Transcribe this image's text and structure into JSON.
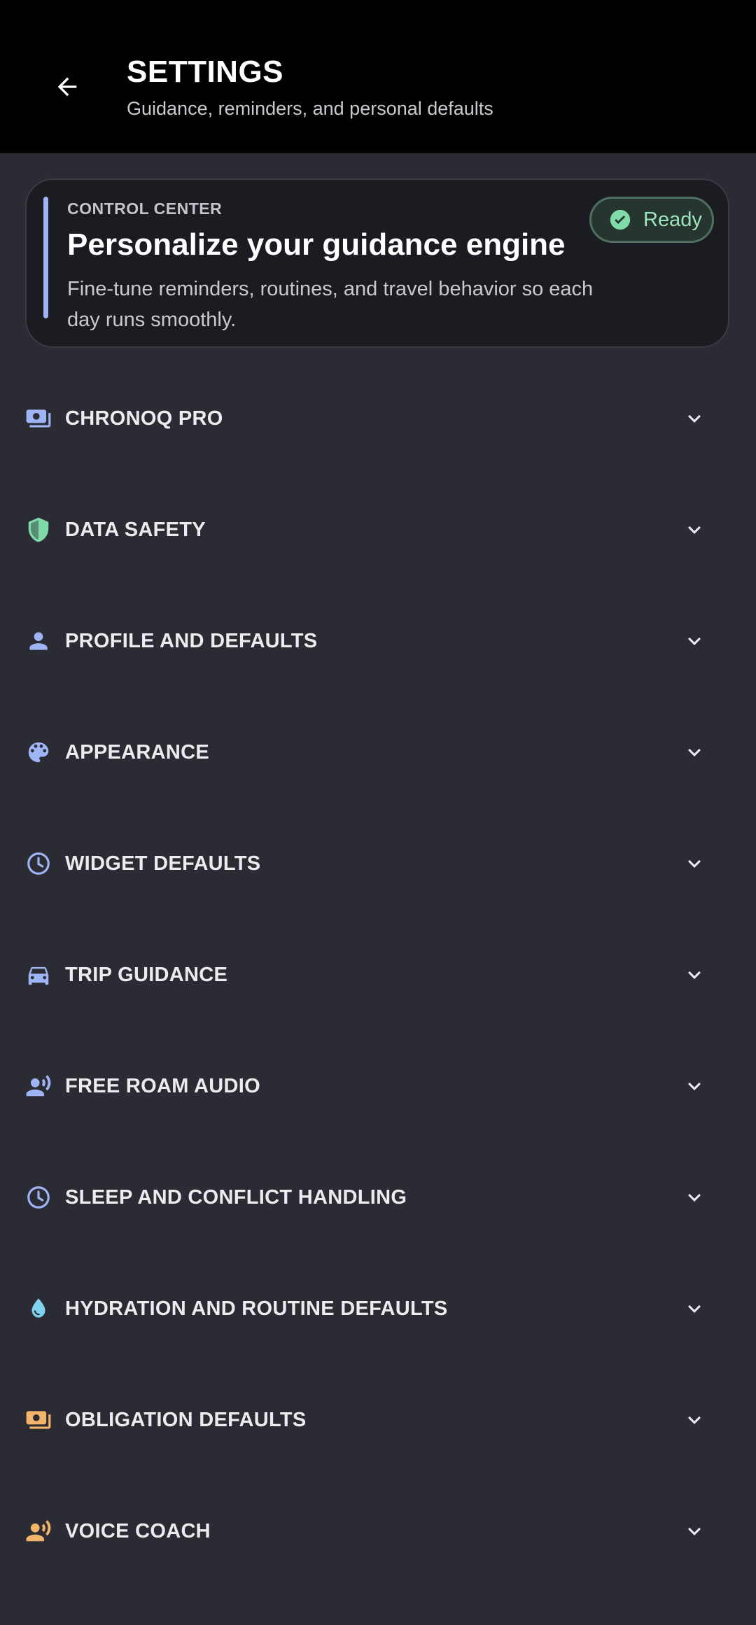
{
  "header": {
    "title": "SETTINGS",
    "subtitle": "Guidance, reminders, and personal defaults",
    "back_icon": "arrow-back-icon"
  },
  "hero": {
    "overline": "CONTROL CENTER",
    "title": "Personalize your guidance engine",
    "body": "Fine-tune reminders, routines, and travel behavior so each day runs smoothly.",
    "status_label": "Ready",
    "status_icon": "check-circle-icon",
    "accent_color": "#9fb4f5",
    "status_color": "#9ee3bf"
  },
  "sections": [
    {
      "label": "CHRONOQ PRO",
      "icon": "payments-icon",
      "icon_color": "#9fb4f5"
    },
    {
      "label": "DATA SAFETY",
      "icon": "shield-icon",
      "icon_color": "#7fdcaa"
    },
    {
      "label": "PROFILE AND DEFAULTS",
      "icon": "person-icon",
      "icon_color": "#9fb4f5"
    },
    {
      "label": "APPEARANCE",
      "icon": "palette-icon",
      "icon_color": "#9fb4f5"
    },
    {
      "label": "WIDGET DEFAULTS",
      "icon": "clock-icon",
      "icon_color": "#9fb4f5"
    },
    {
      "label": "TRIP GUIDANCE",
      "icon": "car-icon",
      "icon_color": "#9fb4f5"
    },
    {
      "label": "FREE ROAM AUDIO",
      "icon": "record-voice-icon",
      "icon_color": "#9fb4f5"
    },
    {
      "label": "SLEEP AND CONFLICT HANDLING",
      "icon": "clock-icon",
      "icon_color": "#9fb4f5"
    },
    {
      "label": "HYDRATION AND ROUTINE DEFAULTS",
      "icon": "water-drop-icon",
      "icon_color": "#7fd3f0"
    },
    {
      "label": "OBLIGATION DEFAULTS",
      "icon": "payments-icon",
      "icon_color": "#f2b36b"
    },
    {
      "label": "VOICE COACH",
      "icon": "record-voice-icon",
      "icon_color": "#f2b36b"
    }
  ]
}
